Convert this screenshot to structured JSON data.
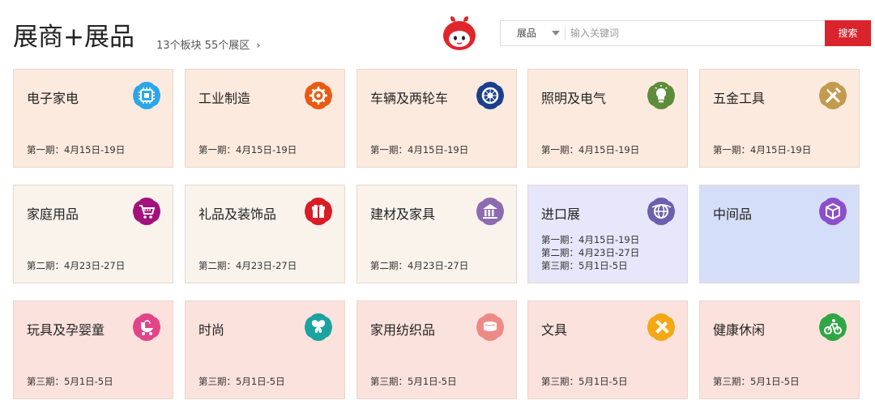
{
  "header": {
    "title": "展商+展品",
    "subtitle": "13个板块 55个展区",
    "subtitle_chevron": "›",
    "mascot_icon": "red-mascot-icon"
  },
  "search": {
    "category": "展品",
    "placeholder": "输入关键词",
    "button_label": "搜索",
    "button_color": "#d9232d"
  },
  "sections": [
    {
      "name": "电子家电",
      "icon": "chip-icon",
      "icon_color": "#2aa7e8",
      "bg": "#fdeade",
      "dates": [
        "第一期：4月15日-19日"
      ]
    },
    {
      "name": "工业制造",
      "icon": "gear-icon",
      "icon_color": "#ea5a13",
      "bg": "#fdeade",
      "dates": [
        "第一期：4月15日-19日"
      ]
    },
    {
      "name": "车辆及两轮车",
      "icon": "wheel-icon",
      "icon_color": "#1b3f8f",
      "bg": "#fdeade",
      "dates": [
        "第一期：4月15日-19日"
      ]
    },
    {
      "name": "照明及电气",
      "icon": "bulb-icon",
      "icon_color": "#5e8c3a",
      "bg": "#fdeade",
      "dates": [
        "第一期：4月15日-19日"
      ]
    },
    {
      "name": "五金工具",
      "icon": "tools-icon",
      "icon_color": "#c39a4e",
      "bg": "#fdeade",
      "dates": [
        "第一期：4月15日-19日"
      ]
    },
    {
      "name": "家庭用品",
      "icon": "cart-icon",
      "icon_color": "#a3127b",
      "bg": "#f9f3ec",
      "dates": [
        "第二期：4月23日-27日"
      ]
    },
    {
      "name": "礼品及装饰品",
      "icon": "gift-icon",
      "icon_color": "#d91c25",
      "bg": "#f9f3ec",
      "dates": [
        "第二期：4月23日-27日"
      ]
    },
    {
      "name": "建材及家具",
      "icon": "building-icon",
      "icon_color": "#8d6bb1",
      "bg": "#f9f3ec",
      "dates": [
        "第二期：4月23日-27日"
      ]
    },
    {
      "name": "进口展",
      "icon": "globe-icon",
      "icon_color": "#6c5fae",
      "bg": "#e7e6fa",
      "dates": [
        "第一期：4月15日-19日",
        "第二期：4月23日-27日",
        "第三期：5月1日-5日"
      ]
    },
    {
      "name": "中间品",
      "icon": "box-icon",
      "icon_color": "#8c4ecb",
      "bg": "#d5def9",
      "dates": []
    },
    {
      "name": "玩具及孕婴童",
      "icon": "stroller-icon",
      "icon_color": "#e24487",
      "bg": "#fbe2dd",
      "dates": [
        "第三期：5月1日-5日"
      ]
    },
    {
      "name": "时尚",
      "icon": "butterfly-icon",
      "icon_color": "#1aa3a0",
      "bg": "#fbe2dd",
      "dates": [
        "第三期：5月1日-5日"
      ]
    },
    {
      "name": "家用纺织品",
      "icon": "pillow-icon",
      "icon_color": "#ee8a86",
      "bg": "#fbe2dd",
      "dates": [
        "第三期：5月1日-5日"
      ]
    },
    {
      "name": "文具",
      "icon": "pencil-ruler-icon",
      "icon_color": "#f4a814",
      "bg": "#fbe2dd",
      "dates": [
        "第三期：5月1日-5日"
      ]
    },
    {
      "name": "健康休闲",
      "icon": "bicycle-icon",
      "icon_color": "#2fa744",
      "bg": "#fbe2dd",
      "dates": [
        "第三期：5月1日-5日"
      ]
    }
  ]
}
